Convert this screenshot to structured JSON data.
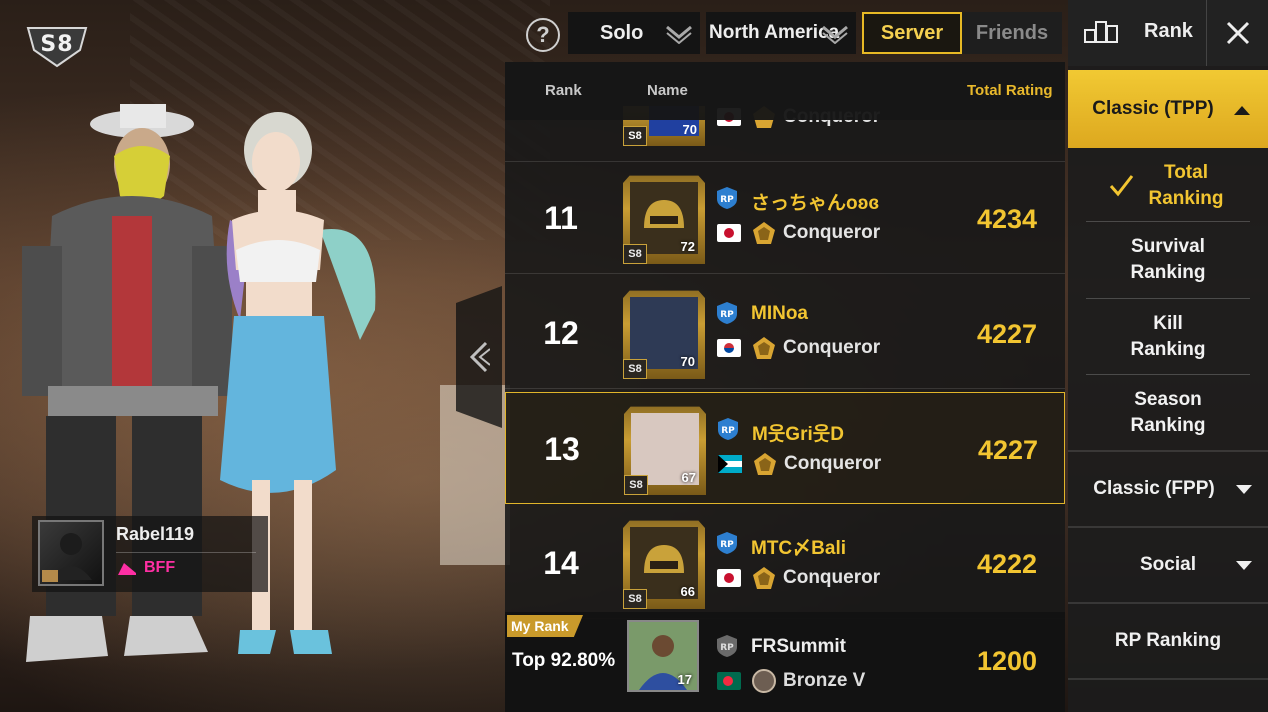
{
  "season": {
    "badge": "S8"
  },
  "player": {
    "name": "Rabel119",
    "relation": "BFF"
  },
  "topbar": {
    "help": "?",
    "mode": "Solo",
    "region": "North America",
    "server_tab": "Server",
    "friends_tab": "Friends"
  },
  "table": {
    "headers": {
      "rank": "Rank",
      "name": "Name",
      "total": "Total Rating"
    },
    "partial_row": {
      "tier": "Conqueror",
      "level": "70"
    },
    "rows": [
      {
        "rank": "11",
        "name": "さっちゃんoʚɞ",
        "tier": "Conqueror",
        "score": "4234",
        "level": "72",
        "flag": "JP"
      },
      {
        "rank": "12",
        "name": "MINoa",
        "tier": "Conqueror",
        "score": "4227",
        "level": "70",
        "flag": "KR"
      },
      {
        "rank": "13",
        "name": "M웃Gri웃D",
        "tier": "Conqueror",
        "score": "4227",
        "level": "67",
        "flag": "BS"
      },
      {
        "rank": "14",
        "name": "MTC〆Bali",
        "tier": "Conqueror",
        "score": "4222",
        "level": "66",
        "flag": "JP"
      }
    ],
    "season_tag": "S8"
  },
  "my_rank": {
    "label": "My Rank",
    "top": "Top 92.80%",
    "name": "FRSummit",
    "tier": "Bronze V",
    "score": "1200",
    "level": "17"
  },
  "right_panel": {
    "title": "Rank",
    "active_category": "Classic (TPP)",
    "sub_items": [
      "Total Ranking",
      "Survival Ranking",
      "Kill Ranking",
      "Season Ranking"
    ],
    "categories": [
      "Classic (FPP)",
      "Social",
      "RP Ranking"
    ]
  },
  "colors": {
    "accent": "#f2c531",
    "panel": "#1c1c1c",
    "bff": "#ff2fa4"
  },
  "icons": [
    "help-icon",
    "chevron-down-icon",
    "close-icon",
    "rank-icon",
    "rp-icon",
    "conqueror-icon",
    "bronze-icon",
    "check-icon",
    "collapse-arrow-icon"
  ]
}
